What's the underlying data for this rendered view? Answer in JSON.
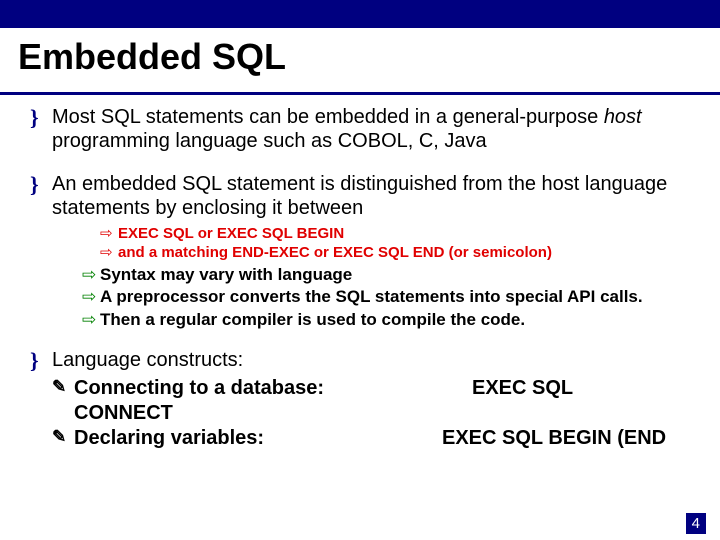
{
  "title": "Embedded SQL",
  "bullets": {
    "b1": {
      "pre": "Most SQL statements can be embedded in a general-purpose ",
      "host": "host",
      "post": " programming language such as COBOL, C, Java"
    },
    "b2": {
      "text": "An embedded SQL statement is distinguished from the host language statements by enclosing it between",
      "red1": "EXEC SQL or EXEC SQL BEGIN",
      "red2": "and a matching END-EXEC  or EXEC SQL END (or semicolon)",
      "g1": "Syntax may vary with language",
      "g2": "A preprocessor converts the SQL statements into special API calls.",
      "g3": "Then a regular compiler is used to compile the code."
    },
    "b3": {
      "heading": "Language constructs:",
      "row1_label": "Connecting to a database:",
      "row1_cmd_a": "EXEC SQL",
      "row1_cmd_b": "CONNECT",
      "row2_label": "Declaring variables:",
      "row2_cmd": "EXEC SQL BEGIN (END"
    }
  },
  "page_number": "4"
}
